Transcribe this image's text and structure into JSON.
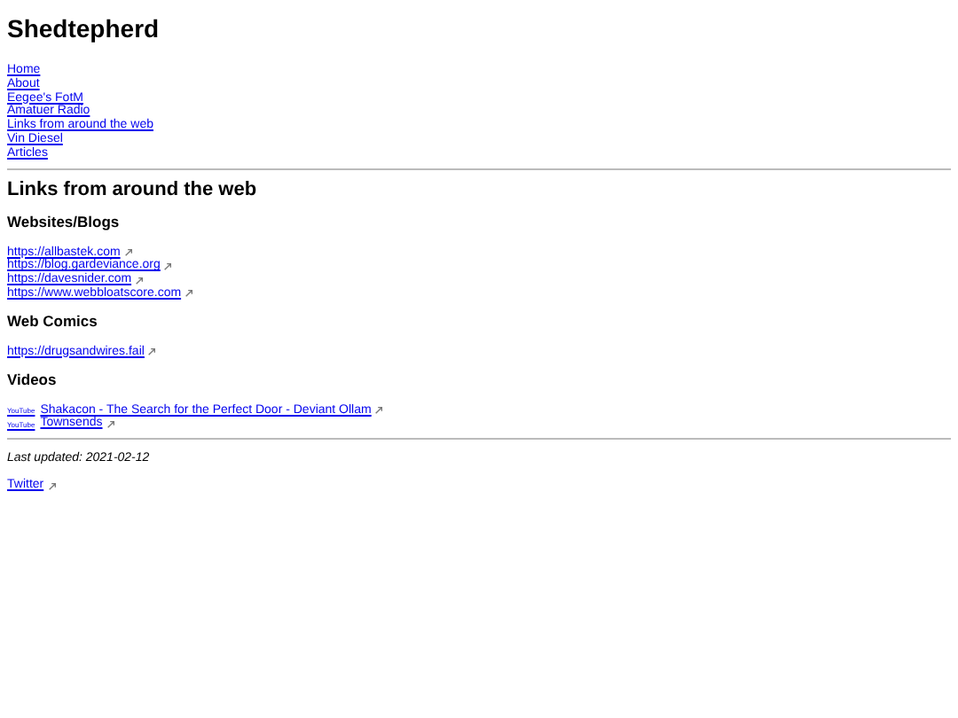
{
  "site_title": "Shedtepherd",
  "nav": [
    "Home",
    "About",
    "Eegee's FotM",
    "Amatuer Radio",
    "Links from around the web",
    "Vin Diesel",
    "Articles"
  ],
  "heading": "Links from around the web",
  "sections": [
    {
      "title": "Websites/Blogs",
      "links": [
        {
          "kind": "plain",
          "text": "https://allbastek.com"
        },
        {
          "kind": "plain",
          "text": "https://blog.gardeviance.org"
        },
        {
          "kind": "plain",
          "text": "https://davesnider.com"
        },
        {
          "kind": "plain",
          "text": "https://www.webbloatscore.com"
        }
      ]
    },
    {
      "title": "Web Comics",
      "links": [
        {
          "kind": "plain",
          "text": "https://drugsandwires.fail"
        }
      ]
    },
    {
      "title": "Videos",
      "links": [
        {
          "kind": "video",
          "source": "YouTube",
          "text": "Shakacon - The Search for the Perfect Door - Deviant Ollam"
        },
        {
          "kind": "video",
          "source": "YouTube",
          "text": "Townsends"
        }
      ]
    }
  ],
  "last_updated": "Last updated: 2021-02-12",
  "footer_links": [
    "Twitter"
  ]
}
